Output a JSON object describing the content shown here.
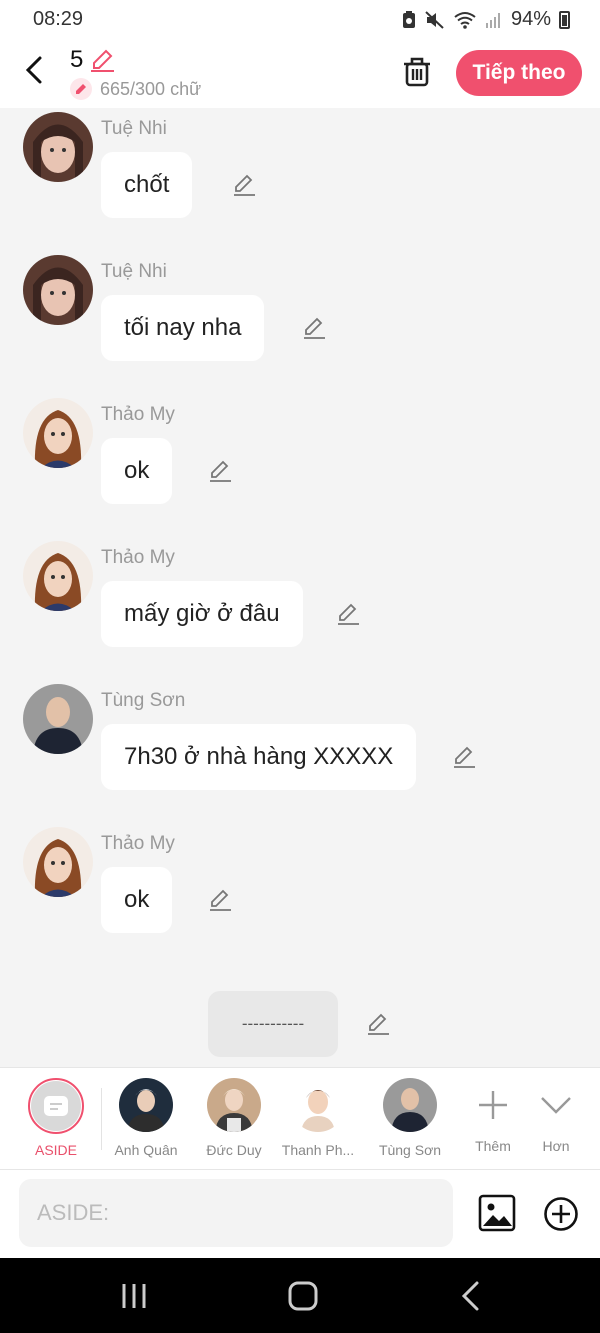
{
  "status": {
    "time": "08:29",
    "battery": "94%"
  },
  "header": {
    "count": "5",
    "words": "665/300 chữ",
    "next_label": "Tiếp theo"
  },
  "messages": [
    {
      "sender": "Tuệ Nhi",
      "text": "chốt",
      "avatar": "tue-nhi"
    },
    {
      "sender": "Tuệ Nhi",
      "text": "tối nay nha",
      "avatar": "tue-nhi"
    },
    {
      "sender": "Thảo My",
      "text": "ok",
      "avatar": "thao-my"
    },
    {
      "sender": "Thảo My",
      "text": "mấy giờ ở đâu",
      "avatar": "thao-my"
    },
    {
      "sender": "Tùng Sơn",
      "text": "7h30 ở nhà hàng XXXXX",
      "avatar": "tung-son"
    },
    {
      "sender": "Thảo My",
      "text": "ok",
      "avatar": "thao-my"
    }
  ],
  "aside_bubble": "-----------",
  "characters": [
    {
      "label": "ASIDE"
    },
    {
      "label": "Anh Quân"
    },
    {
      "label": "Đức Duy"
    },
    {
      "label": "Thanh Ph..."
    },
    {
      "label": "Tùng Sơn"
    },
    {
      "label": "Thêm"
    },
    {
      "label": "Hơn"
    }
  ],
  "input": {
    "placeholder": "ASIDE:"
  },
  "colors": {
    "accent": "#f0506e",
    "background": "#f4f4f4"
  }
}
